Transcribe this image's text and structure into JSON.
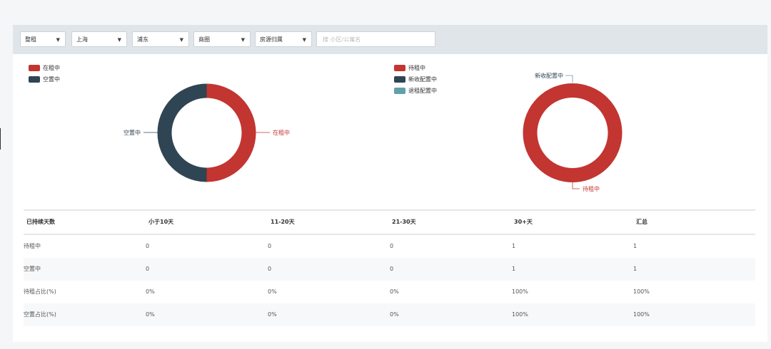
{
  "filters": {
    "type": "整租",
    "city": "上海",
    "district": "浦东",
    "area": "商圈",
    "ownership": "房源归属",
    "search_placeholder": "搜 小区/公寓名"
  },
  "chart_data": [
    {
      "type": "pie",
      "legend": [
        "在租中",
        "空置中"
      ],
      "labels": [
        "在租中",
        "空置中"
      ],
      "values": [
        1,
        1
      ],
      "colors": [
        "#c23531",
        "#2f4554"
      ]
    },
    {
      "type": "pie",
      "legend": [
        "待租中",
        "新收配置中",
        "退租配置中"
      ],
      "labels": [
        "待租中",
        "新收配置中",
        "退租配置中"
      ],
      "values": [
        1,
        0,
        0
      ],
      "colors": [
        "#c23531",
        "#2f4554",
        "#61a0a8"
      ]
    }
  ],
  "chart_labels": {
    "c1_rent": "在租中",
    "c1_vacant": "空置中",
    "c2_top": "新收配置中",
    "c2_bottom": "待租中"
  },
  "table": {
    "headers": [
      "已持续天数",
      "小于10天",
      "11-20天",
      "21-30天",
      "30+天",
      "汇总"
    ],
    "rows": [
      [
        "待租中",
        "0",
        "0",
        "0",
        "1",
        "1"
      ],
      [
        "空置中",
        "0",
        "0",
        "0",
        "1",
        "1"
      ],
      [
        "待租占比(%)",
        "0%",
        "0%",
        "0%",
        "100%",
        "100%"
      ],
      [
        "空置占比(%)",
        "0%",
        "0%",
        "0%",
        "100%",
        "100%"
      ]
    ]
  }
}
